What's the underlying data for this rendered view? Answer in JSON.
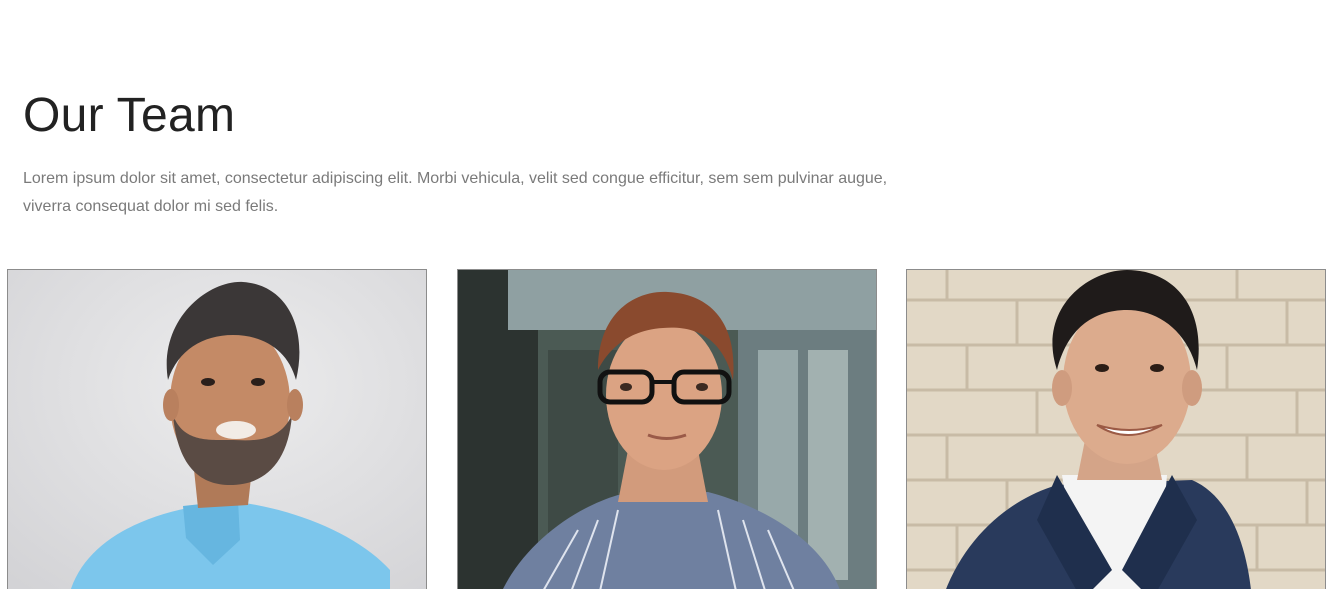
{
  "section": {
    "title": "Our Team",
    "description": "Lorem ipsum dolor sit amet, consectetur adipiscing elit. Morbi vehicula, velit sed congue efficitur, sem sem pulvinar augue, viverra consequat dolor mi sed felis."
  },
  "team": {
    "members": [
      {
        "photo_icon": "man-in-blue-shirt-photo"
      },
      {
        "photo_icon": "woman-with-glasses-photo"
      },
      {
        "photo_icon": "man-in-navy-suit-photo"
      }
    ]
  },
  "colors": {
    "heading": "#222222",
    "body_text": "#7a7a7a",
    "card_border": "#8c8c8c",
    "background": "#ffffff"
  }
}
